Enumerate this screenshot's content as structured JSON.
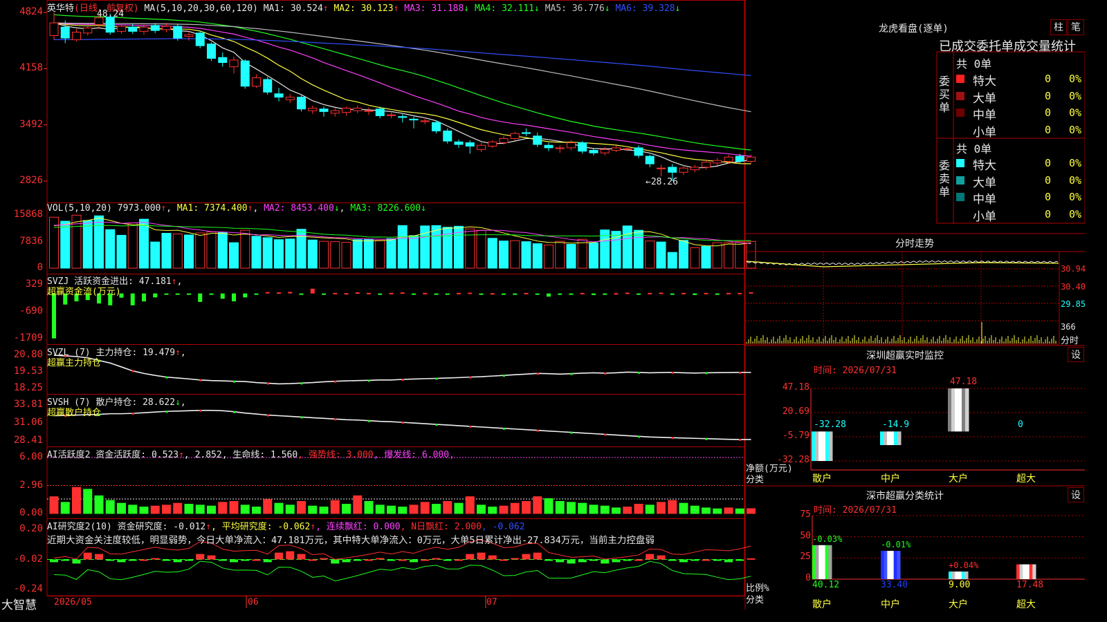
{
  "app": {
    "brand": "大智慧",
    "date_start": "2026/05",
    "month_marks": [
      "06",
      "07"
    ]
  },
  "main_chart": {
    "name": "英华特",
    "period": "(日线，前复权)",
    "ma_label": "MA(5,10,20,30,60,120)",
    "ma": [
      {
        "label": "MA1: 30.524",
        "arrow": "↑",
        "color": "#e8e8e8"
      },
      {
        "label": "MA2: 30.123",
        "arrow": "↑",
        "color": "#ffff40"
      },
      {
        "label": "MA3: 31.188",
        "arrow": "↓",
        "color": "#ff40ff"
      },
      {
        "label": "MA4: 32.111",
        "arrow": "↓",
        "color": "#20ff20"
      },
      {
        "label": "MA5: 36.776",
        "arrow": "↓",
        "color": "#c0c0c0"
      },
      {
        "label": "MA6: 39.328",
        "arrow": "↓",
        "color": "#3050ff"
      }
    ],
    "high_label": "48.24",
    "low_label": "←28.26",
    "y_ticks": [
      "4824",
      "4158",
      "3492",
      "2826"
    ]
  },
  "chart_data": [
    {
      "type": "candlestick",
      "title": "英华特 (日线，前复权)",
      "ylim": [
        28.26,
        48.24
      ],
      "candles": [
        {
          "o": 45.5,
          "c": 47.0,
          "h": 48.24,
          "l": 45.0
        },
        {
          "o": 46.5,
          "c": 45.2,
          "h": 47.3,
          "l": 44.6
        },
        {
          "o": 45.0,
          "c": 45.9,
          "h": 46.3,
          "l": 44.8
        },
        {
          "o": 45.8,
          "c": 46.4,
          "h": 46.8,
          "l": 45.5
        },
        {
          "o": 46.8,
          "c": 47.6,
          "h": 48.0,
          "l": 46.3
        },
        {
          "o": 47.7,
          "c": 45.9,
          "h": 48.1,
          "l": 45.6
        },
        {
          "o": 46.0,
          "c": 46.6,
          "h": 47.0,
          "l": 45.7
        },
        {
          "o": 46.5,
          "c": 46.0,
          "h": 46.9,
          "l": 45.7
        },
        {
          "o": 46.0,
          "c": 46.5,
          "h": 46.8,
          "l": 45.6
        },
        {
          "o": 46.7,
          "c": 46.1,
          "h": 47.0,
          "l": 45.8
        },
        {
          "o": 46.2,
          "c": 46.6,
          "h": 47.0,
          "l": 45.9
        },
        {
          "o": 46.6,
          "c": 45.2,
          "h": 46.9,
          "l": 44.9
        },
        {
          "o": 45.4,
          "c": 45.6,
          "h": 46.0,
          "l": 44.9
        },
        {
          "o": 45.8,
          "c": 44.3,
          "h": 46.1,
          "l": 44.0
        },
        {
          "o": 44.5,
          "c": 42.8,
          "h": 44.7,
          "l": 42.5
        },
        {
          "o": 42.9,
          "c": 42.3,
          "h": 43.5,
          "l": 41.8
        },
        {
          "o": 41.8,
          "c": 42.6,
          "h": 43.0,
          "l": 41.0
        },
        {
          "o": 42.5,
          "c": 39.5,
          "h": 42.7,
          "l": 39.2
        },
        {
          "o": 39.5,
          "c": 40.5,
          "h": 40.9,
          "l": 39.3
        },
        {
          "o": 40.3,
          "c": 38.8,
          "h": 40.6,
          "l": 38.5
        },
        {
          "o": 38.6,
          "c": 38.2,
          "h": 39.3,
          "l": 37.7
        },
        {
          "o": 37.9,
          "c": 38.2,
          "h": 38.6,
          "l": 37.5
        },
        {
          "o": 38.2,
          "c": 36.8,
          "h": 38.4,
          "l": 36.5
        },
        {
          "o": 36.6,
          "c": 36.9,
          "h": 37.2,
          "l": 36.2
        },
        {
          "o": 36.8,
          "c": 36.5,
          "h": 37.1,
          "l": 35.9
        },
        {
          "o": 36.3,
          "c": 36.6,
          "h": 36.9,
          "l": 35.9
        },
        {
          "o": 36.4,
          "c": 36.9,
          "h": 37.1,
          "l": 36.0
        },
        {
          "o": 36.6,
          "c": 36.9,
          "h": 37.2,
          "l": 36.3
        },
        {
          "o": 36.6,
          "c": 36.6,
          "h": 37.0,
          "l": 36.1
        },
        {
          "o": 36.8,
          "c": 36.0,
          "h": 37.1,
          "l": 35.7
        },
        {
          "o": 36.1,
          "c": 36.1,
          "h": 36.5,
          "l": 35.7
        },
        {
          "o": 35.9,
          "c": 35.8,
          "h": 36.2,
          "l": 35.2
        },
        {
          "o": 35.6,
          "c": 35.5,
          "h": 35.9,
          "l": 34.5
        },
        {
          "o": 35.3,
          "c": 35.4,
          "h": 35.8,
          "l": 35.0
        },
        {
          "o": 35.2,
          "c": 34.2,
          "h": 35.4,
          "l": 33.9
        },
        {
          "o": 34.2,
          "c": 33.0,
          "h": 34.5,
          "l": 32.7
        },
        {
          "o": 32.9,
          "c": 32.6,
          "h": 33.2,
          "l": 32.2
        },
        {
          "o": 32.8,
          "c": 32.4,
          "h": 33.1,
          "l": 31.5
        },
        {
          "o": 32.0,
          "c": 32.5,
          "h": 32.8,
          "l": 31.7
        },
        {
          "o": 32.4,
          "c": 32.9,
          "h": 33.1,
          "l": 32.2
        },
        {
          "o": 32.8,
          "c": 33.3,
          "h": 33.6,
          "l": 32.6
        },
        {
          "o": 33.3,
          "c": 33.9,
          "h": 34.1,
          "l": 33.1
        },
        {
          "o": 34.0,
          "c": 33.9,
          "h": 34.5,
          "l": 33.6
        },
        {
          "o": 33.6,
          "c": 32.6,
          "h": 34.0,
          "l": 32.3
        },
        {
          "o": 32.5,
          "c": 32.2,
          "h": 32.8,
          "l": 31.8
        },
        {
          "o": 32.1,
          "c": 32.2,
          "h": 32.5,
          "l": 31.6
        },
        {
          "o": 32.2,
          "c": 32.8,
          "h": 33.1,
          "l": 31.9
        },
        {
          "o": 32.8,
          "c": 31.8,
          "h": 33.0,
          "l": 31.5
        },
        {
          "o": 31.9,
          "c": 31.6,
          "h": 32.2,
          "l": 31.3
        },
        {
          "o": 31.6,
          "c": 32.0,
          "h": 32.3,
          "l": 31.3
        },
        {
          "o": 31.9,
          "c": 32.2,
          "h": 32.5,
          "l": 31.7
        },
        {
          "o": 32.1,
          "c": 32.1,
          "h": 32.4,
          "l": 31.8
        },
        {
          "o": 32.2,
          "c": 31.3,
          "h": 32.5,
          "l": 31.0
        },
        {
          "o": 31.2,
          "c": 30.3,
          "h": 31.4,
          "l": 29.9
        },
        {
          "o": 29.8,
          "c": 29.8,
          "h": 30.2,
          "l": 28.8
        },
        {
          "o": 29.9,
          "c": 29.3,
          "h": 30.3,
          "l": 28.26
        },
        {
          "o": 29.3,
          "c": 29.8,
          "h": 30.1,
          "l": 29.0
        },
        {
          "o": 29.6,
          "c": 29.9,
          "h": 30.2,
          "l": 29.3
        },
        {
          "o": 29.9,
          "c": 30.5,
          "h": 30.8,
          "l": 29.6
        },
        {
          "o": 30.4,
          "c": 30.7,
          "h": 31.0,
          "l": 30.1
        },
        {
          "o": 30.6,
          "c": 31.1,
          "h": 31.4,
          "l": 30.3
        },
        {
          "o": 31.2,
          "c": 30.6,
          "h": 31.5,
          "l": 30.3
        },
        {
          "o": 30.6,
          "c": 31.1,
          "h": 31.4,
          "l": 30.4
        }
      ]
    },
    {
      "type": "bar",
      "title": "VOL(5,10,20)",
      "ylim": [
        0,
        15868
      ],
      "values": [
        15200,
        14000,
        15800,
        14200,
        15600,
        11500,
        9800,
        13500,
        14600,
        7800,
        10400,
        10200,
        9900,
        10500,
        10800,
        10600,
        7600,
        11300,
        9500,
        9100,
        8500,
        8700,
        11600,
        8400,
        8000,
        7900,
        7700,
        8500,
        8600,
        8300,
        8800,
        12700,
        9700,
        12600,
        12700,
        12200,
        12500,
        11700,
        11300,
        8900,
        8100,
        8200,
        7900,
        7300,
        6900,
        8000,
        7100,
        8600,
        7600,
        11400,
        11000,
        12600,
        11300,
        8100,
        7800,
        4700,
        8300,
        6100,
        6500,
        7600,
        7600,
        7900,
        7973
      ],
      "up": [
        true,
        false,
        true,
        false,
        false,
        false,
        false,
        true,
        false,
        false,
        false,
        true,
        false,
        true,
        true,
        false,
        false,
        true,
        false,
        false,
        false,
        false,
        false,
        false,
        true,
        true,
        true,
        false,
        false,
        true,
        false,
        false,
        false,
        false,
        false,
        false,
        false,
        true,
        true,
        false,
        false,
        true,
        false,
        false,
        true,
        true,
        false,
        true,
        false,
        false,
        false,
        false,
        false,
        true,
        false,
        false,
        false,
        true,
        false,
        true,
        true,
        true,
        true
      ],
      "series": [
        {
          "name": "MA1",
          "last": 7374.4
        },
        {
          "name": "MA2",
          "last": 8453.4
        },
        {
          "name": "MA3",
          "last": 8226.6
        }
      ]
    },
    {
      "type": "bar",
      "title": "SVZJ 活跃资金进出",
      "ylim": [
        -1709,
        329
      ],
      "values": [
        -1700,
        -420,
        -300,
        -250,
        -380,
        -450,
        -160,
        -450,
        -300,
        -150,
        -20,
        -30,
        -20,
        -320,
        -40,
        -200,
        -300,
        -150,
        -20,
        50,
        40,
        60,
        -30,
        180,
        -20,
        20,
        10,
        40,
        20,
        -50,
        20,
        40,
        -30,
        20,
        -10,
        -50,
        20,
        30,
        -40,
        10,
        -30,
        -40,
        20,
        -30,
        -120,
        -20,
        -40,
        20,
        -60,
        -20,
        10,
        30,
        -40,
        20,
        30,
        -20,
        20,
        -60,
        20,
        -30,
        20,
        20,
        47
      ],
      "last": 47.181
    },
    {
      "type": "line",
      "title": "SVZL (7) 主力持仓",
      "ylim": [
        18.25,
        20.8
      ],
      "values": [
        20.8,
        20.75,
        20.7,
        20.6,
        20.4,
        20.2,
        19.9,
        19.6,
        19.4,
        19.25,
        19.12,
        19.05,
        18.98,
        18.9,
        18.85,
        18.83,
        18.8,
        18.78,
        18.7,
        18.65,
        18.6,
        18.62,
        18.66,
        18.7,
        18.76,
        18.8,
        18.83,
        18.85,
        18.87,
        18.9,
        18.9,
        18.94,
        18.97,
        19.0,
        19.02,
        19.05,
        19.08,
        19.12,
        19.15,
        19.2,
        19.25,
        19.3,
        19.35,
        19.4,
        19.38,
        19.35,
        19.38,
        19.42,
        19.45,
        19.42,
        19.45,
        19.5,
        19.48,
        19.45,
        19.47,
        19.48,
        19.45,
        19.43,
        19.45,
        19.46,
        19.47,
        19.48,
        19.479
      ]
    },
    {
      "type": "line",
      "title": "SVSH (7) 散户持仓",
      "ylim": [
        28.41,
        33.81
      ],
      "values": [
        32.2,
        32.25,
        32.3,
        32.35,
        32.4,
        32.5,
        32.5,
        32.55,
        32.65,
        32.75,
        32.85,
        32.9,
        32.95,
        33.0,
        33.0,
        32.95,
        32.8,
        32.6,
        32.45,
        32.3,
        32.2,
        32.1,
        32.0,
        31.9,
        31.8,
        31.7,
        31.6,
        31.55,
        31.45,
        31.35,
        31.3,
        31.2,
        31.1,
        31.0,
        30.9,
        30.8,
        30.7,
        30.6,
        30.5,
        30.4,
        30.3,
        30.2,
        30.1,
        30.0,
        29.9,
        29.8,
        29.7,
        29.6,
        29.5,
        29.4,
        29.3,
        29.2,
        29.1,
        29.0,
        28.95,
        28.9,
        28.85,
        28.8,
        28.75,
        28.7,
        28.65,
        28.62,
        28.622
      ]
    },
    {
      "type": "bar",
      "title": "AI活跃度2 资金活跃度",
      "ylim": [
        0,
        6.0
      ],
      "values": [
        1.8,
        1.2,
        2.8,
        2.6,
        1.9,
        1.4,
        1.1,
        0.9,
        0.7,
        0.8,
        0.9,
        1.1,
        1.0,
        0.9,
        0.8,
        1.2,
        1.3,
        0.9,
        0.7,
        1.5,
        1.1,
        0.9,
        1.3,
        0.8,
        0.7,
        1.4,
        1.0,
        1.9,
        1.3,
        0.9,
        0.8,
        0.7,
        0.9,
        1.2,
        1.0,
        1.3,
        1.1,
        1.8,
        0.9,
        0.7,
        0.8,
        1.1,
        1.3,
        1.8,
        1.6,
        1.3,
        1.2,
        1.1,
        0.9,
        0.8,
        0.6,
        0.7,
        1.0,
        0.9,
        1.2,
        1.4,
        1.1,
        0.8,
        0.6,
        0.5,
        0.6,
        0.5,
        0.523
      ],
      "line_values": {
        "强势线": 3.0,
        "爆发线": 6.0,
        "生命线": 1.56
      }
    },
    {
      "type": "bar",
      "title": "AI研究度2(10) 资金研究度",
      "ylim": [
        -0.24,
        0.2
      ],
      "values": [
        -0.04,
        -0.03,
        -0.05,
        0.03,
        0.02,
        -0.03,
        -0.04,
        -0.03,
        -0.02,
        -0.01,
        -0.03,
        -0.04,
        -0.03,
        0.02,
        0.01,
        -0.03,
        -0.04,
        -0.03,
        -0.02,
        -0.04,
        0.03,
        0.04,
        0.02,
        -0.02,
        -0.01,
        -0.05,
        -0.04,
        -0.03,
        -0.02,
        -0.01,
        -0.03,
        -0.02,
        -0.04,
        -0.02,
        -0.01,
        -0.03,
        -0.02,
        0.02,
        0.03,
        0.01,
        -0.02,
        -0.01,
        0.02,
        0.03,
        -0.03,
        -0.04,
        -0.05,
        -0.04,
        -0.03,
        -0.05,
        -0.04,
        -0.03,
        -0.02,
        0.02,
        0.01,
        -0.03,
        -0.04,
        -0.03,
        -0.02,
        -0.03,
        -0.04,
        -0.03,
        -0.012
      ]
    },
    {
      "type": "bar",
      "title": "深圳超赢实时监控",
      "categories": [
        "散户",
        "中户",
        "大户",
        "超大"
      ],
      "values": [
        -32.28,
        -14.9,
        47.18,
        0
      ],
      "ylim": [
        -32.28,
        47.18
      ]
    },
    {
      "type": "bar",
      "title": "深市超赢分类统计",
      "categories": [
        "散户",
        "中户",
        "大户",
        "超大"
      ],
      "values": [
        40.12,
        33.4,
        9.0,
        17.48
      ],
      "changes": [
        "-0.03%",
        "-0.01%",
        "+0.04%",
        ""
      ],
      "ylim": [
        0,
        75
      ]
    }
  ],
  "panels": {
    "vol": {
      "label": "VOL(5,10,20)",
      "value": "7973.000",
      "arrow": "↑",
      "ma1": "MA1: 7374.400",
      "ma1_arrow": "↑",
      "ma2": "MA2: 8453.400",
      "ma2_arrow": "↓",
      "ma3": "MA3: 8226.600",
      "ma3_arrow": "↓",
      "y_ticks": [
        "15868",
        "7836",
        "0"
      ]
    },
    "svzj": {
      "label": "SVZJ  活跃资金进出: 47.181",
      "arrow": "↑",
      "sub": "超赢资金流(万元)",
      "y_ticks": [
        "329",
        "-690",
        "-1709"
      ]
    },
    "svzl": {
      "label": "SVZL (7) 主力持仓: 19.479",
      "arrow": "↑",
      "sub": "超赢主力持仓",
      "y_ticks": [
        "20.80",
        "19.53",
        "18.25"
      ]
    },
    "svsh": {
      "label": "SVSH (7) 散户持仓: 28.622",
      "arrow": "↓",
      "sub": "超赢散户持仓",
      "y_ticks": [
        "33.81",
        "31.06",
        "28.41"
      ]
    },
    "ai_active": {
      "label": "AI活跃度2 资金活跃度: 0.523",
      "arrow": "↑",
      "v2": ", 2.852",
      "life": ", 生命线: 1.560",
      "strong": ", 强势线: 3.000",
      "burst": ", 爆发线: 6.000,",
      "y_ticks": [
        "6.00",
        "2.96",
        "0.00"
      ]
    },
    "ai_research": {
      "label": "AI研究度2(10) 资金研究度: -0.012",
      "arrow": "↑",
      "avg": ", 平均研究度: -0.062",
      "avg_arrow": "↑",
      "red": ", 连续飘红: 0.000",
      "nred": ", N日飘红: 2.000",
      "last": ", -0.062",
      "comment": "近期大资金关注度较低，明显弱势，今日大单净流入：47.181万元，其中特大单净流入：0万元，大单5日累计净出-27.834万元，当前主力控盘弱",
      "y_ticks": [
        "0.20",
        "-0.02",
        "-0.24"
      ]
    }
  },
  "right": {
    "lhb_title": "龙虎看盘(逐单)",
    "btn_zhu": "柱",
    "btn_bi": "笔",
    "order_title": "已成交委托单成交量统计",
    "buy_label": "委买单",
    "sell_label": "委卖单",
    "buy_total": "共 0单",
    "sell_total": "共 0单",
    "buy_rows": [
      {
        "name": "特大",
        "num": "0",
        "pct": "0%",
        "color": "#ff2020"
      },
      {
        "name": "大单",
        "num": "0",
        "pct": "0%",
        "color": "#a01010"
      },
      {
        "name": "中单",
        "num": "0",
        "pct": "0%",
        "color": "#700000"
      },
      {
        "name": "小单",
        "num": "0",
        "pct": "0%",
        "color": "#000000"
      }
    ],
    "sell_rows": [
      {
        "name": "特大",
        "num": "0",
        "pct": "0%",
        "color": "#20ffff"
      },
      {
        "name": "大单",
        "num": "0",
        "pct": "0%",
        "color": "#10a0a0"
      },
      {
        "name": "中单",
        "num": "0",
        "pct": "0%",
        "color": "#007878"
      },
      {
        "name": "小单",
        "num": "0",
        "pct": "0%",
        "color": "#000000"
      }
    ],
    "intraday_title": "分时走势",
    "intraday_ticks": [
      "30.94",
      "30.40",
      "29.85",
      "366",
      "分时"
    ],
    "monitor_title": "深圳超赢实时监控",
    "monitor_time": "时间: 2026/07/31",
    "set_btn": "设",
    "monitor_ticks": [
      "47.18",
      "20.69",
      "-5.79",
      "-32.28"
    ],
    "monitor_values": [
      "-32.28",
      "-14.9",
      "47.18",
      "0"
    ],
    "monitor_ylabel": "净额(万元)",
    "cat_label": "分类",
    "categories": [
      "散户",
      "中户",
      "大户",
      "超大"
    ],
    "stat_title": "深市超赢分类统计",
    "stat_time": "时间: 2026/07/31",
    "stat_ticks": [
      "75",
      "50",
      "25",
      "0"
    ],
    "stat_changes": [
      "-0.03%",
      "-0.01%",
      "+0.04%"
    ],
    "stat_values": [
      "40.12",
      "33.40",
      "9.00",
      "17.48"
    ],
    "stat_ylabel": "比例%"
  }
}
